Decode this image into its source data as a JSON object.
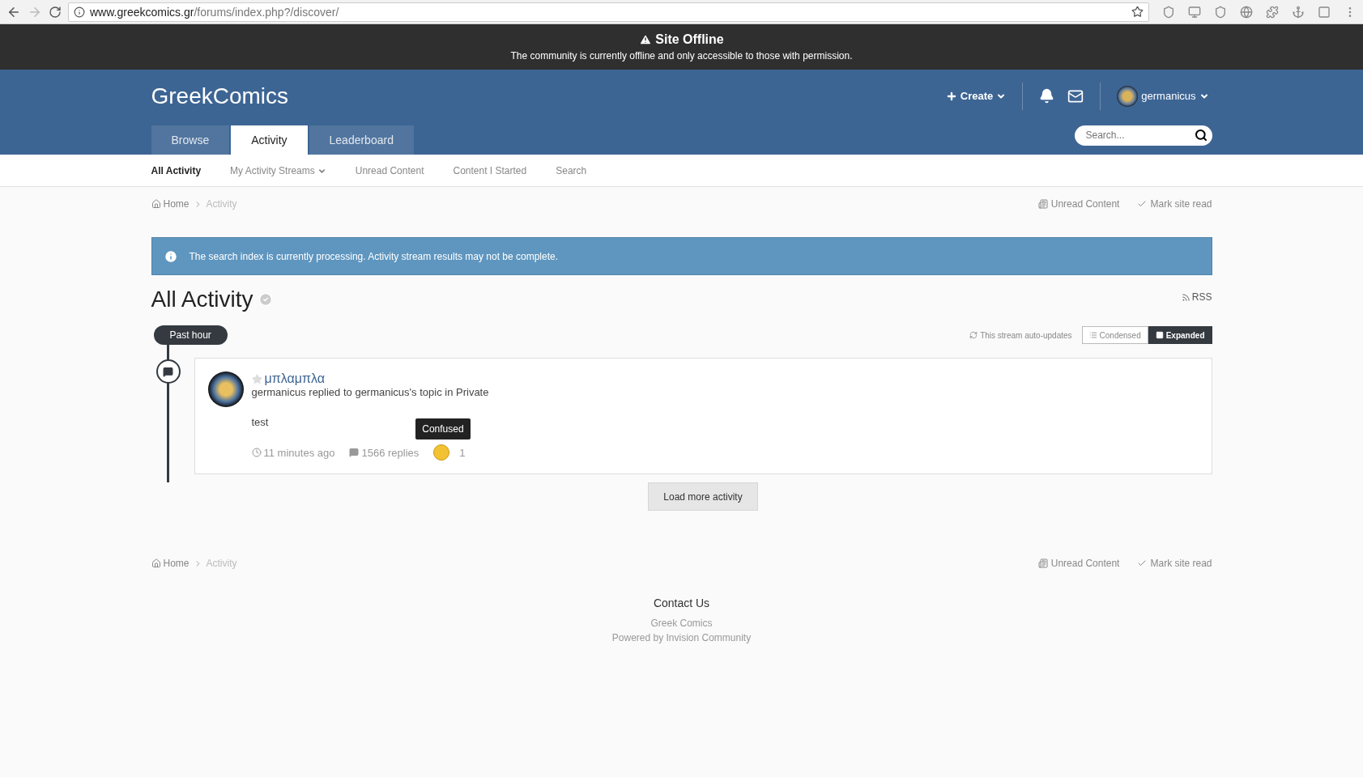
{
  "browser": {
    "url_host": "www.greekcomics.gr",
    "url_path": "/forums/index.php?/discover/"
  },
  "offline_banner": {
    "title": "Site Offline",
    "message": "The community is currently offline and only accessible to those with permission."
  },
  "header": {
    "site_name": "GreekComics",
    "create": "Create",
    "username": "germanicus",
    "search": {
      "placeholder": "Search..."
    }
  },
  "tabs": [
    {
      "label": "Browse",
      "selected": false
    },
    {
      "label": "Activity",
      "selected": true
    },
    {
      "label": "Leaderboard",
      "selected": false
    }
  ],
  "sub_nav": [
    {
      "label": "All Activity",
      "selected": true,
      "dropdown": false
    },
    {
      "label": "My Activity Streams",
      "selected": false,
      "dropdown": true
    },
    {
      "label": "Unread Content",
      "selected": false,
      "dropdown": false
    },
    {
      "label": "Content I Started",
      "selected": false,
      "dropdown": false
    },
    {
      "label": "Search",
      "selected": false,
      "dropdown": false
    }
  ],
  "breadcrumb": {
    "items": [
      "Home",
      "Activity"
    ],
    "actions": [
      "Unread Content",
      "Mark site read"
    ]
  },
  "notice": "The search index is currently processing. Activity stream results may not be complete.",
  "page_title": "All Activity",
  "rss": "RSS",
  "stream": {
    "period": "Past hour",
    "auto_updates": "This stream auto-updates",
    "views": [
      {
        "label": "Condensed",
        "selected": false
      },
      {
        "label": "Expanded",
        "selected": true
      }
    ]
  },
  "activity": {
    "title": "μπλαμπλα",
    "summary": "germanicus replied to germanicus's topic in Private",
    "snippet": "test",
    "time": "11 minutes ago",
    "replies": "1566 replies",
    "reaction_tooltip": "Confused",
    "reaction_count": "1"
  },
  "load_more": "Load more activity",
  "footer_breadcrumb": {
    "items": [
      "Home",
      "Activity"
    ],
    "actions": [
      "Unread Content",
      "Mark site read"
    ]
  },
  "footer": {
    "contact": "Contact Us",
    "site": "Greek Comics",
    "powered_by": "Powered by Invision Community"
  }
}
